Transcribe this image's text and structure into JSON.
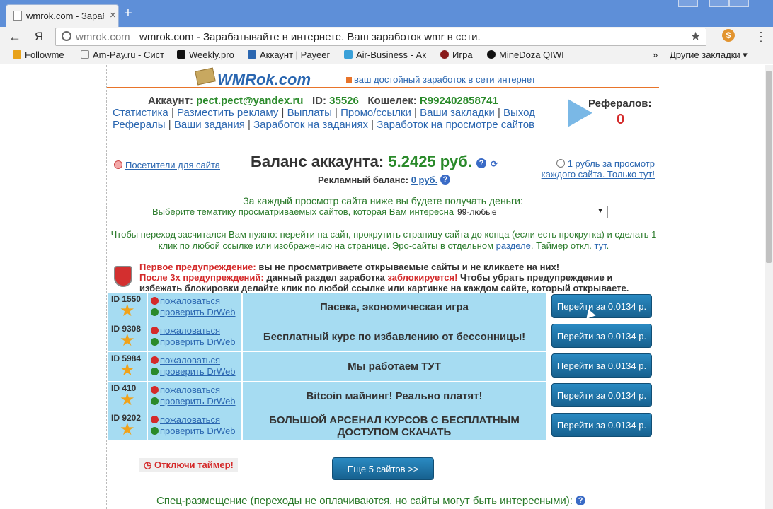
{
  "browser": {
    "tab_title": "wmrok.com - Зарабат",
    "omnibox_host": "wmrok.com",
    "omnibox_text": "wmrok.com - Зарабатывайте в интернете. Ваш заработок wmr в сети.",
    "bookmarks": [
      "Followme",
      "Am-Pay.ru - Сист",
      "Weekly.pro",
      "Аккаунт | Payeer",
      "Air-Business - Ак",
      "Игра",
      "MineDoza QIWI"
    ],
    "bookmarks_more": "»",
    "other_bookmarks": "Другие закладки",
    "ext_symbol": "$"
  },
  "header": {
    "logo": "WMRok.com",
    "slogan": "ваш достойный заработок в сети интернет"
  },
  "account": {
    "label": "Аккаунт:",
    "email": "pect.pect@yandex.ru",
    "id_label": "ID:",
    "id": "35526",
    "wallet_label": "Кошелек:",
    "wallet": "R992402858741"
  },
  "nav": {
    "row1": [
      "Статистика",
      "Разместить рекламу",
      "Выплаты",
      "Промо/ссылки",
      "Ваши закладки",
      "Выход"
    ],
    "row2": [
      "Рефералы",
      "Ваши задания",
      "Заработок на заданиях",
      "Заработок на просмотре сайтов"
    ]
  },
  "referrals": {
    "label": "Рефералов:",
    "count": "0"
  },
  "balance": {
    "visitors_link": "Посетители для сайта",
    "label": "Баланс аккаунта:",
    "value": "5.2425 руб.",
    "ad_label": "Рекламный баланс:",
    "ad_value": "0 руб.",
    "promo": "1 рубль за просмотр каждого сайта. Только тут!"
  },
  "info": {
    "earn_text": "За каждый просмотр сайта ниже вы будете получать деньги:",
    "theme_label": "Выберите тематику просматриваемых сайтов, которая Вам интересна:",
    "theme_value": "99-любые",
    "note_main": "Чтобы переход засчитался Вам нужно: перейти на сайт, прокрутить страницу сайта до конца (если есть прокрутка) и сделать 1 клик по любой ссылке или изображению на странице. Эро-сайты в отдельном ",
    "note_link1": "разделе",
    "note_mid": ". Таймер откл. ",
    "note_link2": "тут",
    "note_end": "."
  },
  "warning": {
    "first_label": "Первое предупреждение:",
    "first_text": " вы не просматриваете открываемые сайты и не кликаете на них!",
    "after_label": "После 3х предупреждений:",
    "after_text1": " данный раздел заработка ",
    "blocked": "заблокируется!",
    "after_text2": " Чтобы убрать предупреждение и избежать блокировки делайте клик по любой ссылке или картинке на каждом сайте, который открываете."
  },
  "sites": [
    {
      "id": "ID 1550",
      "complain": "пожаловаться",
      "check": "проверить DrWeb",
      "title": "Пасека, экономическая игра",
      "button": "Перейти за 0.0134 р."
    },
    {
      "id": "ID 9308",
      "complain": "пожаловаться",
      "check": "проверить DrWeb",
      "title": "Бесплатный курс по избавлению от бессонницы!",
      "button": "Перейти за 0.0134 р."
    },
    {
      "id": "ID 5984",
      "complain": "пожаловаться",
      "check": "проверить DrWeb",
      "title": "Мы работаем ТУТ",
      "button": "Перейти за 0.0134 р."
    },
    {
      "id": "ID 410",
      "complain": "пожаловаться",
      "check": "проверить DrWeb",
      "title": "Bitcoin майнинг! Реально платят!",
      "button": "Перейти за 0.0134 р."
    },
    {
      "id": "ID 9202",
      "complain": "пожаловаться",
      "check": "проверить DrWeb",
      "title": "БОЛЬШОЙ АРСЕНАЛ КУРСОВ С БЕСПЛАТНЫМ ДОСТУПОМ СКАЧАТЬ",
      "button": "Перейти за 0.0134 р."
    }
  ],
  "footer": {
    "timer_off": "Отключи таймер!",
    "more_button": "Еще 5 сайтов >>",
    "special_link": "Спец-размещение",
    "special_text": " (переходы не оплачиваются, но сайты могут быть интересными):"
  },
  "colors": {
    "cell_bg": "#a6dcf2",
    "button_blue": "#1f76a8",
    "green_text": "#2a7a2a",
    "red_text": "#d42a2a",
    "link_blue": "#2a66b0",
    "accent_orange": "#e8742a"
  }
}
